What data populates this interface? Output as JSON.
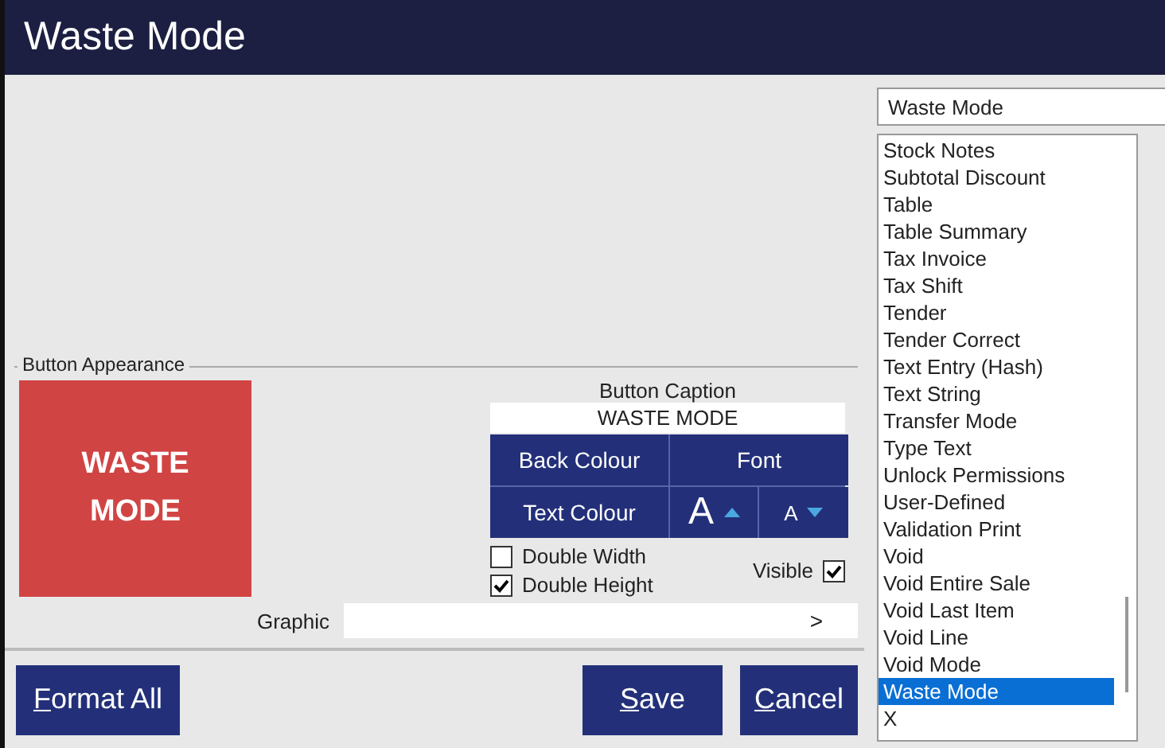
{
  "window": {
    "title": "Waste Mode"
  },
  "function_select": {
    "value": "Waste Mode"
  },
  "function_list": [
    {
      "label": "Stock Notes",
      "selected": false
    },
    {
      "label": "Subtotal Discount",
      "selected": false
    },
    {
      "label": "Table",
      "selected": false
    },
    {
      "label": "Table Summary",
      "selected": false
    },
    {
      "label": "Tax Invoice",
      "selected": false
    },
    {
      "label": "Tax Shift",
      "selected": false
    },
    {
      "label": "Tender",
      "selected": false
    },
    {
      "label": "Tender Correct",
      "selected": false
    },
    {
      "label": "Text Entry (Hash)",
      "selected": false
    },
    {
      "label": "Text String",
      "selected": false
    },
    {
      "label": "Transfer Mode",
      "selected": false
    },
    {
      "label": "Type Text",
      "selected": false
    },
    {
      "label": "Unlock Permissions",
      "selected": false
    },
    {
      "label": "User-Defined",
      "selected": false
    },
    {
      "label": "Validation Print",
      "selected": false
    },
    {
      "label": "Void",
      "selected": false
    },
    {
      "label": "Void Entire Sale",
      "selected": false
    },
    {
      "label": "Void Last Item",
      "selected": false
    },
    {
      "label": "Void Line",
      "selected": false
    },
    {
      "label": "Void Mode",
      "selected": false
    },
    {
      "label": "Waste Mode",
      "selected": true
    },
    {
      "label": "X",
      "selected": false
    }
  ],
  "button_appearance": {
    "legend": "Button Appearance",
    "preview": [
      "WASTE",
      "MODE"
    ],
    "caption_label": "Button Caption",
    "caption": "WASTE  MODE",
    "back_colour": "Back Colour",
    "font": "Font",
    "text_colour": "Text Colour",
    "font_larger": "A",
    "font_smaller": "A",
    "options": [
      {
        "label": "Double Width",
        "checked": false
      },
      {
        "label": "Double Height",
        "checked": true
      }
    ],
    "visible": {
      "label": "Visible",
      "checked": true
    },
    "graphic": {
      "label": "Graphic",
      "browse": ">"
    }
  },
  "buttons": [
    {
      "label": "Format All",
      "mnemonic_underlined": true
    },
    {
      "label": "Save",
      "mnemonic_underlined": true
    },
    {
      "label": "Cancel",
      "mnemonic_underlined": true
    }
  ]
}
